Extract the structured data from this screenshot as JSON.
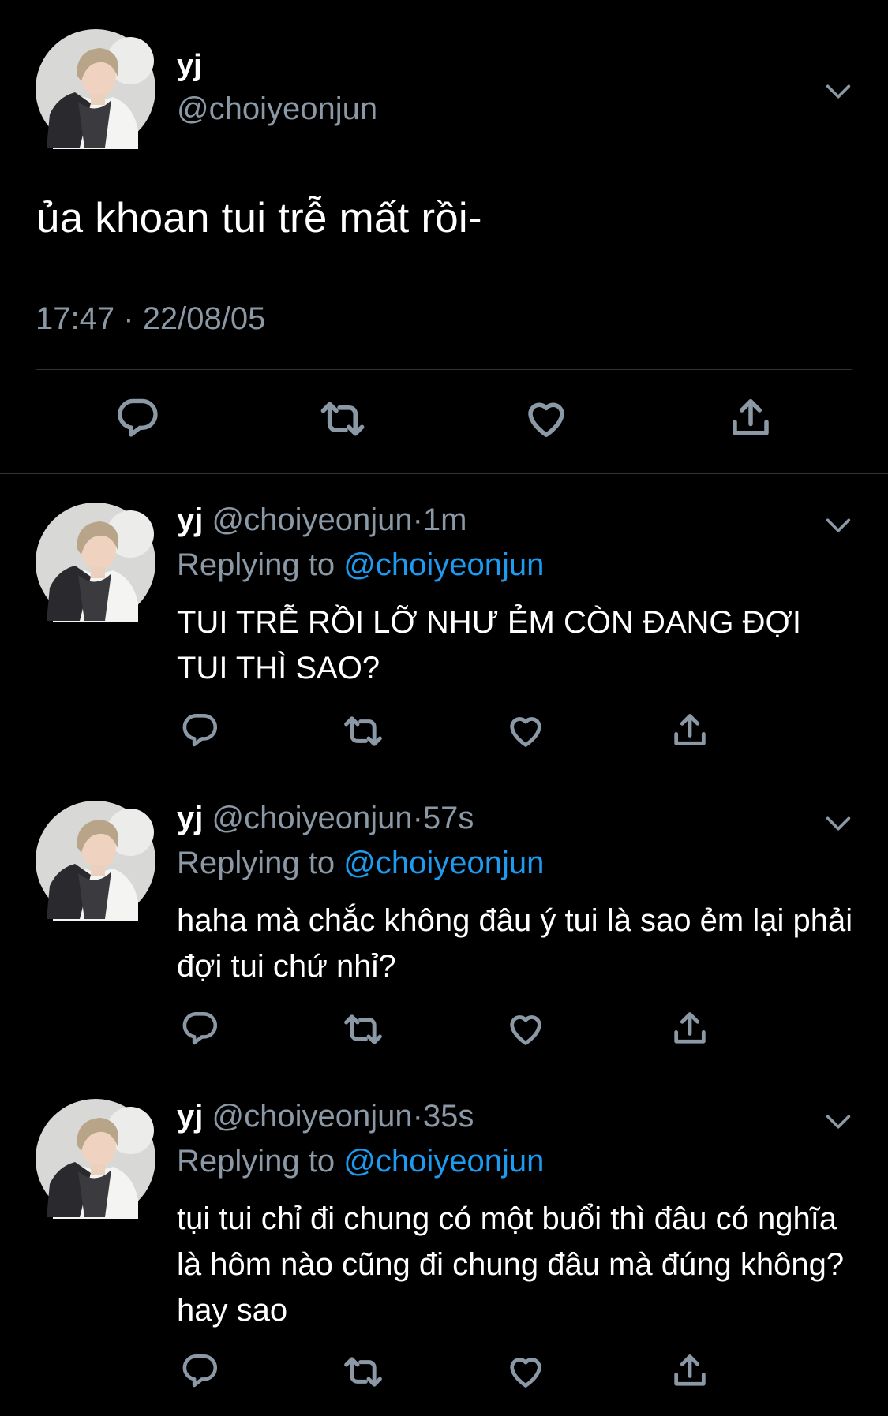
{
  "main_tweet": {
    "name": "yj",
    "handle": "@choiyeonjun",
    "text": "ủa khoan tui trễ mất rồi-",
    "time": "17:47",
    "separator": "·",
    "date": "22/08/05"
  },
  "replies": [
    {
      "name": "yj",
      "handle": "@choiyeonjun",
      "dot": "·",
      "age": "1m",
      "replying_label": "Replying to",
      "replying_to": "@choiyeonjun",
      "text": "TUI TRỄ RỒI LỠ NHƯ ẺM CÒN ĐANG ĐỢI TUI THÌ SAO?"
    },
    {
      "name": "yj",
      "handle": "@choiyeonjun",
      "dot": "·",
      "age": "57s",
      "replying_label": "Replying to",
      "replying_to": "@choiyeonjun",
      "text": "haha mà chắc không đâu ý tui là sao ẻm lại phải đợi tui chứ nhỉ?"
    },
    {
      "name": "yj",
      "handle": "@choiyeonjun",
      "dot": "·",
      "age": "35s",
      "replying_label": "Replying to",
      "replying_to": "@choiyeonjun",
      "text": "tụi tui chỉ đi chung có một buổi thì đâu có nghĩa là hôm nào cũng đi chung đâu mà đúng không? hay sao"
    }
  ],
  "icons": {
    "reply": "reply-icon",
    "retweet": "retweet-icon",
    "like": "like-icon",
    "share": "share-icon",
    "more": "chevron-down-icon"
  },
  "colors": {
    "background": "#000000",
    "text": "#ffffff",
    "secondary": "#8b98a5",
    "mention": "#1d9bf0",
    "divider": "#2f3336"
  }
}
